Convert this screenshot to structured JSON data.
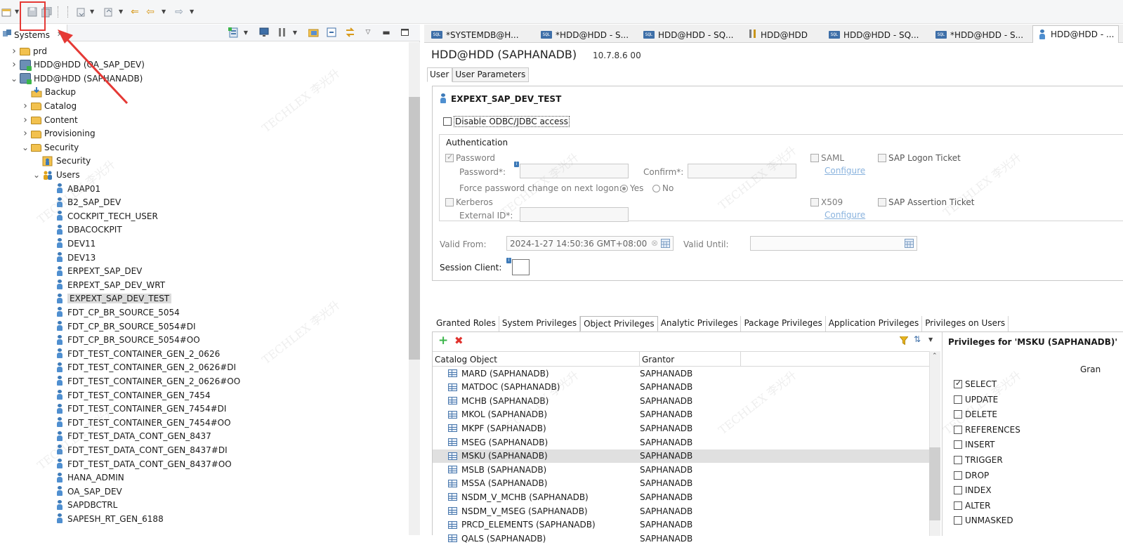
{
  "toolbar": {
    "icons": [
      "new-icon",
      "save-icon",
      "save-all-icon",
      "nav-icon",
      "forward-icon",
      "back-icon",
      "back-arrow-icon",
      "forward-arrow-icon"
    ]
  },
  "systems_view": {
    "tab_label": "Systems",
    "tree": [
      {
        "label": "prd",
        "icon": "folder",
        "indent": 0,
        "twisty": "›"
      },
      {
        "label": "HDD@HDD (OA_SAP_DEV)",
        "icon": "db",
        "indent": 0,
        "twisty": "›"
      },
      {
        "label": "HDD@HDD (SAPHANADB)",
        "icon": "db",
        "indent": 0,
        "twisty": "⌄"
      },
      {
        "label": "Backup",
        "icon": "backup",
        "indent": 1,
        "twisty": ""
      },
      {
        "label": "Catalog",
        "icon": "folder",
        "indent": 1,
        "twisty": "›"
      },
      {
        "label": "Content",
        "icon": "folder",
        "indent": 1,
        "twisty": "›"
      },
      {
        "label": "Provisioning",
        "icon": "folder",
        "indent": 1,
        "twisty": "›"
      },
      {
        "label": "Security",
        "icon": "folder",
        "indent": 1,
        "twisty": "⌄"
      },
      {
        "label": "Security",
        "icon": "security",
        "indent": 2,
        "twisty": ""
      },
      {
        "label": "Users",
        "icon": "users",
        "indent": 2,
        "twisty": "⌄"
      },
      {
        "label": "ABAP01",
        "icon": "user",
        "indent": 3,
        "twisty": ""
      },
      {
        "label": "B2_SAP_DEV",
        "icon": "user",
        "indent": 3,
        "twisty": ""
      },
      {
        "label": "COCKPIT_TECH_USER",
        "icon": "user",
        "indent": 3,
        "twisty": ""
      },
      {
        "label": "DBACOCKPIT",
        "icon": "user",
        "indent": 3,
        "twisty": ""
      },
      {
        "label": "DEV11",
        "icon": "user",
        "indent": 3,
        "twisty": ""
      },
      {
        "label": "DEV13",
        "icon": "user",
        "indent": 3,
        "twisty": ""
      },
      {
        "label": "ERPEXT_SAP_DEV",
        "icon": "user",
        "indent": 3,
        "twisty": ""
      },
      {
        "label": "ERPEXT_SAP_DEV_WRT",
        "icon": "user",
        "indent": 3,
        "twisty": ""
      },
      {
        "label": "EXPEXT_SAP_DEV_TEST",
        "icon": "user",
        "indent": 3,
        "twisty": "",
        "selected": true
      },
      {
        "label": "FDT_CP_BR_SOURCE_5054",
        "icon": "user",
        "indent": 3,
        "twisty": ""
      },
      {
        "label": "FDT_CP_BR_SOURCE_5054#DI",
        "icon": "user",
        "indent": 3,
        "twisty": ""
      },
      {
        "label": "FDT_CP_BR_SOURCE_5054#OO",
        "icon": "user",
        "indent": 3,
        "twisty": ""
      },
      {
        "label": "FDT_TEST_CONTAINER_GEN_2_0626",
        "icon": "user",
        "indent": 3,
        "twisty": ""
      },
      {
        "label": "FDT_TEST_CONTAINER_GEN_2_0626#DI",
        "icon": "user",
        "indent": 3,
        "twisty": ""
      },
      {
        "label": "FDT_TEST_CONTAINER_GEN_2_0626#OO",
        "icon": "user",
        "indent": 3,
        "twisty": ""
      },
      {
        "label": "FDT_TEST_CONTAINER_GEN_7454",
        "icon": "user",
        "indent": 3,
        "twisty": ""
      },
      {
        "label": "FDT_TEST_CONTAINER_GEN_7454#DI",
        "icon": "user",
        "indent": 3,
        "twisty": ""
      },
      {
        "label": "FDT_TEST_CONTAINER_GEN_7454#OO",
        "icon": "user",
        "indent": 3,
        "twisty": ""
      },
      {
        "label": "FDT_TEST_DATA_CONT_GEN_8437",
        "icon": "user",
        "indent": 3,
        "twisty": ""
      },
      {
        "label": "FDT_TEST_DATA_CONT_GEN_8437#DI",
        "icon": "user",
        "indent": 3,
        "twisty": ""
      },
      {
        "label": "FDT_TEST_DATA_CONT_GEN_8437#OO",
        "icon": "user",
        "indent": 3,
        "twisty": ""
      },
      {
        "label": "HANA_ADMIN",
        "icon": "user",
        "indent": 3,
        "twisty": ""
      },
      {
        "label": "OA_SAP_DEV",
        "icon": "user",
        "indent": 3,
        "twisty": ""
      },
      {
        "label": "SAPDBCTRL",
        "icon": "user",
        "indent": 3,
        "twisty": ""
      },
      {
        "label": "SAPESH_RT_GEN_6188",
        "icon": "user",
        "indent": 3,
        "twisty": ""
      }
    ]
  },
  "editor_tabs": [
    {
      "label": "*SYSTEMDB@H...",
      "icon": "sql"
    },
    {
      "label": "*HDD@HDD - S...",
      "icon": "sql"
    },
    {
      "label": "HDD@HDD - SQ...",
      "icon": "sql"
    },
    {
      "label": "HDD@HDD",
      "icon": "tools"
    },
    {
      "label": "HDD@HDD - SQ...",
      "icon": "sql"
    },
    {
      "label": "*HDD@HDD - S...",
      "icon": "sql"
    },
    {
      "label": "HDD@HDD - ...",
      "icon": "user",
      "active": true
    }
  ],
  "editor": {
    "title": "HDD@HDD (SAPHANADB)",
    "version": "10.7.8.6 00",
    "subtabs": [
      "User",
      "User Parameters"
    ],
    "user_name": "EXPEXT_SAP_DEV_TEST",
    "disable_odbc": "Disable ODBC/JDBC access",
    "authentication": {
      "title": "Authentication",
      "password": "Password",
      "password_field": "Password*:",
      "confirm_field": "Confirm*:",
      "force_change": "Force password change on next logon:",
      "yes": "Yes",
      "no": "No",
      "saml": "SAML",
      "sap_logon_ticket": "SAP Logon Ticket",
      "configure": "Configure",
      "kerberos": "Kerberos",
      "external_id": "External ID*:",
      "x509": "X509",
      "sap_assertion_ticket": "SAP Assertion Ticket"
    },
    "valid_from_label": "Valid From:",
    "valid_from_value": "2024-1-27 14:50:36 GMT+08:00",
    "valid_until_label": "Valid Until:",
    "session_client_label": "Session Client:",
    "priv_tabs": [
      "Granted Roles",
      "System Privileges",
      "Object Privileges",
      "Analytic Privileges",
      "Package Privileges",
      "Application Privileges",
      "Privileges on Users"
    ],
    "grid": {
      "columns": [
        "Catalog Object",
        "Grantor"
      ],
      "rows": [
        {
          "object": "MARD (SAPHANADB)",
          "grantor": "SAPHANADB"
        },
        {
          "object": "MATDOC (SAPHANADB)",
          "grantor": "SAPHANADB"
        },
        {
          "object": "MCHB (SAPHANADB)",
          "grantor": "SAPHANADB"
        },
        {
          "object": "MKOL (SAPHANADB)",
          "grantor": "SAPHANADB"
        },
        {
          "object": "MKPF (SAPHANADB)",
          "grantor": "SAPHANADB"
        },
        {
          "object": "MSEG (SAPHANADB)",
          "grantor": "SAPHANADB"
        },
        {
          "object": "MSKU (SAPHANADB)",
          "grantor": "SAPHANADB",
          "selected": true
        },
        {
          "object": "MSLB (SAPHANADB)",
          "grantor": "SAPHANADB"
        },
        {
          "object": "MSSA (SAPHANADB)",
          "grantor": "SAPHANADB"
        },
        {
          "object": "NSDM_V_MCHB (SAPHANADB)",
          "grantor": "SAPHANADB"
        },
        {
          "object": "NSDM_V_MSEG (SAPHANADB)",
          "grantor": "SAPHANADB"
        },
        {
          "object": "PRCD_ELEMENTS (SAPHANADB)",
          "grantor": "SAPHANADB"
        },
        {
          "object": "QALS (SAPHANADB)",
          "grantor": "SAPHANADB"
        }
      ]
    },
    "perm_title": "Privileges for 'MSKU (SAPHANADB)'",
    "perm_col": "Gran",
    "permissions": [
      {
        "label": "SELECT",
        "checked": true
      },
      {
        "label": "UPDATE",
        "checked": false
      },
      {
        "label": "DELETE",
        "checked": false
      },
      {
        "label": "REFERENCES",
        "checked": false
      },
      {
        "label": "INSERT",
        "checked": false
      },
      {
        "label": "TRIGGER",
        "checked": false
      },
      {
        "label": "DROP",
        "checked": false
      },
      {
        "label": "INDEX",
        "checked": false
      },
      {
        "label": "ALTER",
        "checked": false
      },
      {
        "label": "UNMASKED",
        "checked": false
      }
    ]
  },
  "watermark_text": "TECHLEX 李光升",
  "colors": {
    "annotation": "#e53935",
    "selection": "#dcdcdc",
    "link": "#8ab3de"
  }
}
